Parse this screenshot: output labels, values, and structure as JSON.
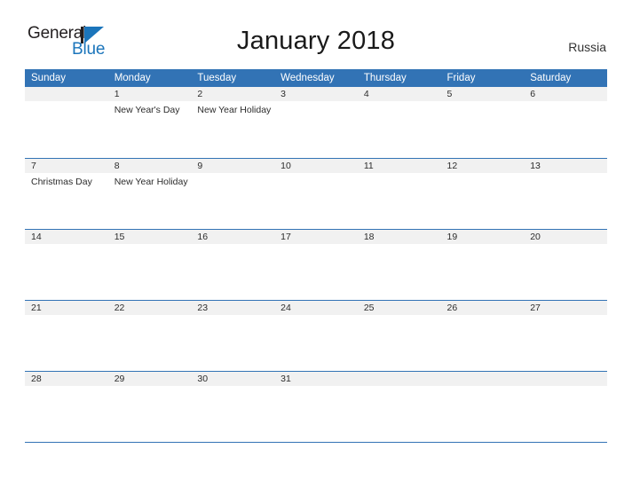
{
  "brand": {
    "name_part1": "General",
    "name_part2": "Blue",
    "mark": "triangle-logo"
  },
  "header": {
    "title": "January 2018",
    "country": "Russia"
  },
  "colors": {
    "header_blue": "#3273b5",
    "brand_blue": "#1b75bb",
    "daynum_band": "#f1f1f1",
    "row_divider": "#3273b5"
  },
  "weekdays": [
    "Sunday",
    "Monday",
    "Tuesday",
    "Wednesday",
    "Thursday",
    "Friday",
    "Saturday"
  ],
  "weeks": [
    [
      {
        "day": "",
        "events": []
      },
      {
        "day": "1",
        "events": [
          "New Year's Day"
        ]
      },
      {
        "day": "2",
        "events": [
          "New Year Holiday"
        ]
      },
      {
        "day": "3",
        "events": []
      },
      {
        "day": "4",
        "events": []
      },
      {
        "day": "5",
        "events": []
      },
      {
        "day": "6",
        "events": []
      }
    ],
    [
      {
        "day": "7",
        "events": [
          "Christmas Day"
        ]
      },
      {
        "day": "8",
        "events": [
          "New Year Holiday"
        ]
      },
      {
        "day": "9",
        "events": []
      },
      {
        "day": "10",
        "events": []
      },
      {
        "day": "11",
        "events": []
      },
      {
        "day": "12",
        "events": []
      },
      {
        "day": "13",
        "events": []
      }
    ],
    [
      {
        "day": "14",
        "events": []
      },
      {
        "day": "15",
        "events": []
      },
      {
        "day": "16",
        "events": []
      },
      {
        "day": "17",
        "events": []
      },
      {
        "day": "18",
        "events": []
      },
      {
        "day": "19",
        "events": []
      },
      {
        "day": "20",
        "events": []
      }
    ],
    [
      {
        "day": "21",
        "events": []
      },
      {
        "day": "22",
        "events": []
      },
      {
        "day": "23",
        "events": []
      },
      {
        "day": "24",
        "events": []
      },
      {
        "day": "25",
        "events": []
      },
      {
        "day": "26",
        "events": []
      },
      {
        "day": "27",
        "events": []
      }
    ],
    [
      {
        "day": "28",
        "events": []
      },
      {
        "day": "29",
        "events": []
      },
      {
        "day": "30",
        "events": []
      },
      {
        "day": "31",
        "events": []
      },
      {
        "day": "",
        "events": []
      },
      {
        "day": "",
        "events": []
      },
      {
        "day": "",
        "events": []
      }
    ]
  ]
}
